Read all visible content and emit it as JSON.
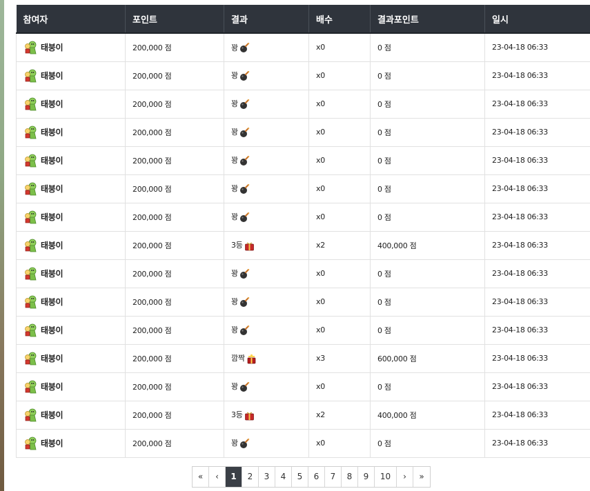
{
  "columns": [
    "참여자",
    "포인트",
    "결과",
    "배수",
    "결과포인트",
    "일시"
  ],
  "rows": [
    {
      "user": "태붕이",
      "point": "200,000 점",
      "result": "꽝",
      "result_icon": "bomb-icon",
      "mult": "x0",
      "result_point": "0 점",
      "date": "23-04-18 06:33"
    },
    {
      "user": "태붕이",
      "point": "200,000 점",
      "result": "꽝",
      "result_icon": "bomb-icon",
      "mult": "x0",
      "result_point": "0 점",
      "date": "23-04-18 06:33"
    },
    {
      "user": "태붕이",
      "point": "200,000 점",
      "result": "꽝",
      "result_icon": "bomb-icon",
      "mult": "x0",
      "result_point": "0 점",
      "date": "23-04-18 06:33"
    },
    {
      "user": "태붕이",
      "point": "200,000 점",
      "result": "꽝",
      "result_icon": "bomb-icon",
      "mult": "x0",
      "result_point": "0 점",
      "date": "23-04-18 06:33"
    },
    {
      "user": "태붕이",
      "point": "200,000 점",
      "result": "꽝",
      "result_icon": "bomb-icon",
      "mult": "x0",
      "result_point": "0 점",
      "date": "23-04-18 06:33"
    },
    {
      "user": "태붕이",
      "point": "200,000 점",
      "result": "꽝",
      "result_icon": "bomb-icon",
      "mult": "x0",
      "result_point": "0 점",
      "date": "23-04-18 06:33"
    },
    {
      "user": "태붕이",
      "point": "200,000 점",
      "result": "꽝",
      "result_icon": "bomb-icon",
      "mult": "x0",
      "result_point": "0 점",
      "date": "23-04-18 06:33"
    },
    {
      "user": "태붕이",
      "point": "200,000 점",
      "result": "3등",
      "result_icon": "gift-icon",
      "mult": "x2",
      "result_point": "400,000 점",
      "date": "23-04-18 06:33"
    },
    {
      "user": "태붕이",
      "point": "200,000 점",
      "result": "꽝",
      "result_icon": "bomb-icon",
      "mult": "x0",
      "result_point": "0 점",
      "date": "23-04-18 06:33"
    },
    {
      "user": "태붕이",
      "point": "200,000 점",
      "result": "꽝",
      "result_icon": "bomb-icon",
      "mult": "x0",
      "result_point": "0 점",
      "date": "23-04-18 06:33"
    },
    {
      "user": "태붕이",
      "point": "200,000 점",
      "result": "꽝",
      "result_icon": "bomb-icon",
      "mult": "x0",
      "result_point": "0 점",
      "date": "23-04-18 06:33"
    },
    {
      "user": "태붕이",
      "point": "200,000 점",
      "result": "깜짝",
      "result_icon": "surprise-gift-icon",
      "mult": "x3",
      "result_point": "600,000 점",
      "date": "23-04-18 06:33"
    },
    {
      "user": "태붕이",
      "point": "200,000 점",
      "result": "꽝",
      "result_icon": "bomb-icon",
      "mult": "x0",
      "result_point": "0 점",
      "date": "23-04-18 06:33"
    },
    {
      "user": "태붕이",
      "point": "200,000 점",
      "result": "3등",
      "result_icon": "gift-icon",
      "mult": "x2",
      "result_point": "400,000 점",
      "date": "23-04-18 06:33"
    },
    {
      "user": "태붕이",
      "point": "200,000 점",
      "result": "꽝",
      "result_icon": "bomb-icon",
      "mult": "x0",
      "result_point": "0 점",
      "date": "23-04-18 06:33"
    }
  ],
  "pagination": {
    "first": "«",
    "prev": "‹",
    "pages": [
      "1",
      "2",
      "3",
      "4",
      "5",
      "6",
      "7",
      "8",
      "9",
      "10"
    ],
    "current": "1",
    "next": "›",
    "last": "»"
  },
  "colors": {
    "header_bg": "#2f343c",
    "active_page": "#3a3f46"
  }
}
